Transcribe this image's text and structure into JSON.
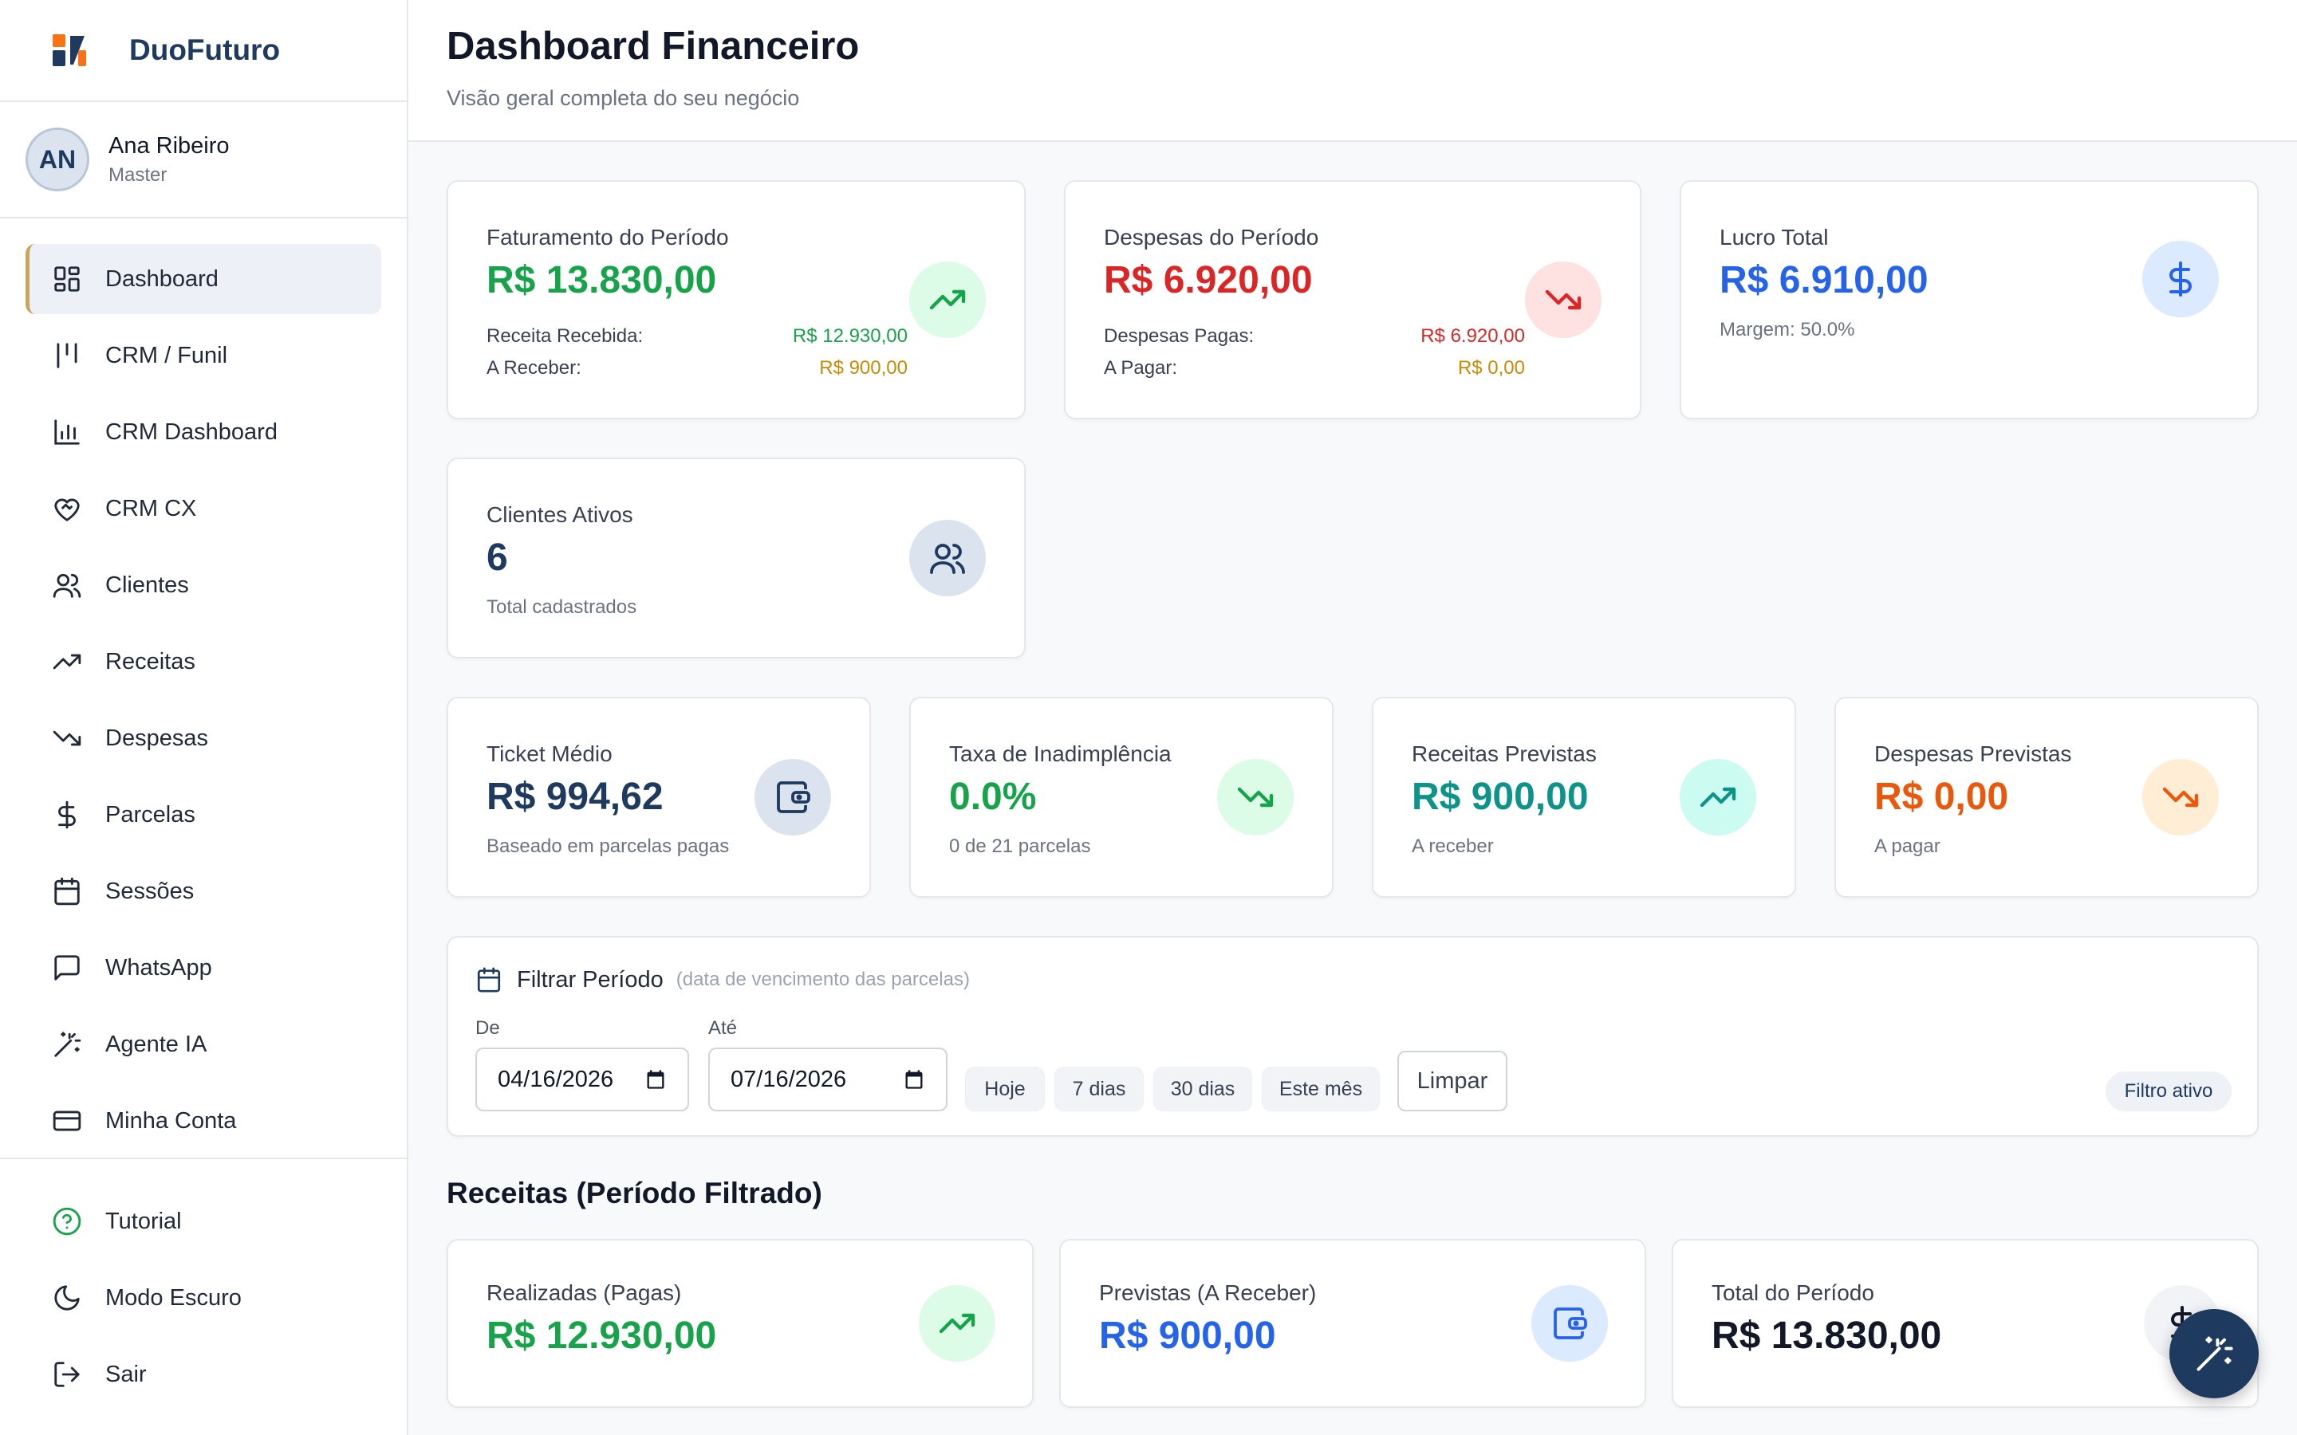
{
  "brand": {
    "name": "DuoFuturo"
  },
  "user": {
    "initials": "AN",
    "name": "Ana Ribeiro",
    "role": "Master"
  },
  "sidebar": {
    "items": [
      {
        "label": "Dashboard",
        "icon": "layout-dashboard-icon",
        "active": true
      },
      {
        "label": "CRM / Funil",
        "icon": "kanban-icon"
      },
      {
        "label": "CRM Dashboard",
        "icon": "bar-chart-icon"
      },
      {
        "label": "CRM CX",
        "icon": "heart-handshake-icon"
      },
      {
        "label": "Clientes",
        "icon": "users-icon"
      },
      {
        "label": "Receitas",
        "icon": "trending-up-icon"
      },
      {
        "label": "Despesas",
        "icon": "trending-down-icon"
      },
      {
        "label": "Parcelas",
        "icon": "dollar-icon"
      },
      {
        "label": "Sessões",
        "icon": "calendar-icon"
      },
      {
        "label": "WhatsApp",
        "icon": "message-square-icon"
      },
      {
        "label": "Agente IA",
        "icon": "magic-wand-icon"
      },
      {
        "label": "Minha Conta",
        "icon": "credit-card-icon"
      }
    ],
    "bottom": [
      {
        "label": "Tutorial",
        "icon": "help-circle-icon"
      },
      {
        "label": "Modo Escuro",
        "icon": "moon-icon"
      },
      {
        "label": "Sair",
        "icon": "logout-icon"
      }
    ]
  },
  "header": {
    "title": "Dashboard Financeiro",
    "subtitle": "Visão geral completa do seu negócio"
  },
  "kpis": {
    "faturamento": {
      "label": "Faturamento do Período",
      "value": "R$ 13.830,00",
      "row1_label": "Receita Recebida:",
      "row1_value": "R$ 12.930,00",
      "row2_label": "A Receber:",
      "row2_value": "R$ 900,00"
    },
    "despesas": {
      "label": "Despesas do Período",
      "value": "R$ 6.920,00",
      "row1_label": "Despesas Pagas:",
      "row1_value": "R$ 6.920,00",
      "row2_label": "A Pagar:",
      "row2_value": "R$ 0,00"
    },
    "lucro": {
      "label": "Lucro Total",
      "value": "R$ 6.910,00",
      "note": "Margem: 50.0%"
    },
    "clientes": {
      "label": "Clientes Ativos",
      "value": "6",
      "note": "Total cadastrados"
    }
  },
  "metrics": {
    "ticket": {
      "label": "Ticket Médio",
      "value": "R$ 994,62",
      "note": "Baseado em parcelas pagas"
    },
    "inadimplencia": {
      "label": "Taxa de Inadimplência",
      "value": "0.0%",
      "note": "0 de 21 parcelas"
    },
    "receitas_previstas": {
      "label": "Receitas Previstas",
      "value": "R$ 900,00",
      "note": "A receber"
    },
    "despesas_previstas": {
      "label": "Despesas Previstas",
      "value": "R$ 0,00",
      "note": "A pagar"
    }
  },
  "filter": {
    "title": "Filtrar Período",
    "hint": "(data de vencimento das parcelas)",
    "from_label": "De",
    "from_value": "04/16/2026",
    "to_label": "Até",
    "to_value": "07/16/2026",
    "quick": [
      "Hoje",
      "7 dias",
      "30 dias",
      "Este mês"
    ],
    "clear_label": "Limpar",
    "status_badge": "Filtro ativo"
  },
  "receitas_section": {
    "title": "Receitas (Período Filtrado)",
    "realizadas": {
      "label": "Realizadas (Pagas)",
      "value": "R$ 12.930,00"
    },
    "previstas": {
      "label": "Previstas (A Receber)",
      "value": "R$ 900,00"
    },
    "total": {
      "label": "Total do Período",
      "value": "R$ 13.830,00"
    }
  },
  "colors": {
    "green": "#16a34a",
    "red": "#dc2626",
    "blue": "#2563eb",
    "navy": "#1e3a5f",
    "teal": "#0d9488",
    "orange": "#ea580c",
    "accent_gold": "#c9a65c"
  }
}
